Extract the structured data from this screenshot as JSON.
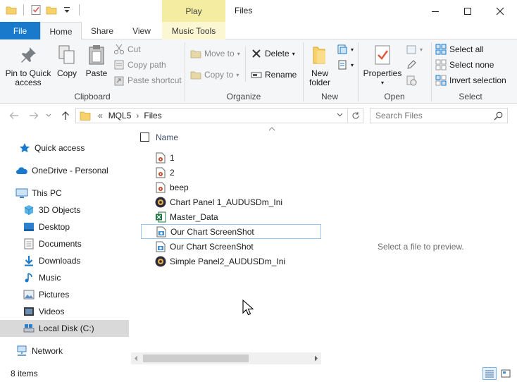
{
  "window": {
    "title": "Files",
    "contextual_tab": "Play",
    "controls": {
      "minimize": "—",
      "maximize": "☐",
      "close": "✕"
    }
  },
  "ribbon_tabs": {
    "file": "File",
    "home": "Home",
    "share": "Share",
    "view": "View",
    "music_tools": "Music Tools"
  },
  "ribbon": {
    "clipboard": {
      "label": "Clipboard",
      "pin": "Pin to Quick access",
      "copy": "Copy",
      "paste": "Paste",
      "cut": "Cut",
      "copy_path": "Copy path",
      "paste_shortcut": "Paste shortcut"
    },
    "organize": {
      "label": "Organize",
      "move_to": "Move to",
      "copy_to": "Copy to",
      "delete": "Delete",
      "rename": "Rename"
    },
    "new": {
      "label": "New",
      "new_folder": "New folder"
    },
    "open": {
      "label": "Open",
      "properties": "Properties"
    },
    "select": {
      "label": "Select",
      "select_all": "Select all",
      "select_none": "Select none",
      "invert_selection": "Invert selection"
    }
  },
  "address": {
    "overflow": "«",
    "crumbs": [
      "MQL5",
      "Files"
    ],
    "separator": "›",
    "search_placeholder": "Search Files"
  },
  "nav": {
    "items": [
      {
        "label": "Quick access",
        "icon": "star-icon"
      },
      {
        "label": "OneDrive - Personal",
        "icon": "cloud-icon"
      },
      {
        "label": "This PC",
        "icon": "computer-icon"
      },
      {
        "label": "3D Objects",
        "icon": "cube-icon"
      },
      {
        "label": "Desktop",
        "icon": "desktop-icon"
      },
      {
        "label": "Documents",
        "icon": "document-icon"
      },
      {
        "label": "Downloads",
        "icon": "download-icon"
      },
      {
        "label": "Music",
        "icon": "music-icon"
      },
      {
        "label": "Pictures",
        "icon": "pictures-icon"
      },
      {
        "label": "Videos",
        "icon": "video-icon"
      },
      {
        "label": "Local Disk (C:)",
        "icon": "drive-icon"
      },
      {
        "label": "Network",
        "icon": "network-icon"
      }
    ],
    "selected_index": 10
  },
  "files": {
    "column_name": "Name",
    "rows": [
      {
        "name": "1",
        "icon": "audio-file-icon"
      },
      {
        "name": "2",
        "icon": "audio-file-icon"
      },
      {
        "name": "beep",
        "icon": "audio-file-icon"
      },
      {
        "name": "Chart Panel 1_AUDUSDm_Ini",
        "icon": "app-file-icon"
      },
      {
        "name": "Master_Data",
        "icon": "excel-file-icon"
      },
      {
        "name": "Our Chart ScreenShot",
        "icon": "image-file-icon"
      },
      {
        "name": "Our Chart ScreenShot",
        "icon": "image-file-icon"
      },
      {
        "name": "Simple Panel2_AUDUSDm_Ini",
        "icon": "app-file-icon"
      }
    ],
    "focused_index": 5
  },
  "preview": {
    "message": "Select a file to preview."
  },
  "status": {
    "item_count": "8 items"
  },
  "colors": {
    "accent": "#1979ca",
    "play_tab": "#f4eca0",
    "selection": "#d9d9d9",
    "focus_border": "#99c7f0"
  }
}
